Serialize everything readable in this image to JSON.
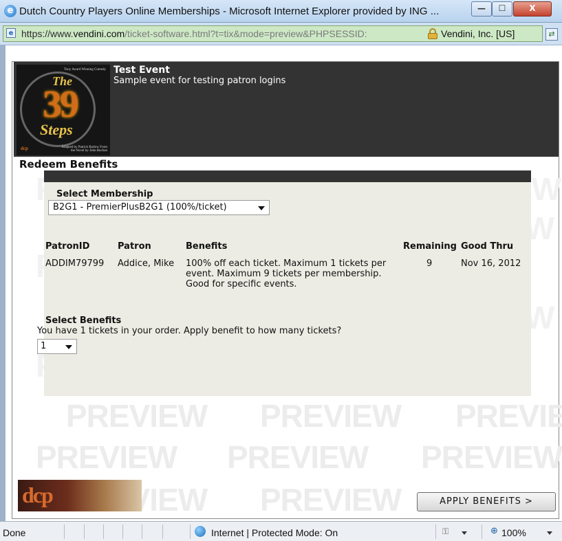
{
  "window": {
    "title": "Dutch Country Players Online Memberships - Microsoft Internet Explorer provided by ING ...",
    "minimize_glyph": "—",
    "maximize_glyph": "☐",
    "close_glyph": "X"
  },
  "address_bar": {
    "url_scheme": "https://www.",
    "url_domain": "vendini.com",
    "url_path": "/ticket-software.html?t=tix&mode=preview&PHPSESSID:",
    "certificate": "Vendini, Inc. [US]"
  },
  "event": {
    "poster_tagline": "Tony Award Winning Comedy",
    "poster_the": "The",
    "poster_number": "39",
    "poster_steps": "Steps",
    "poster_credit": "Adapted by Patrick Barlow From the Novel by John Buchan",
    "poster_brand": "dcp",
    "title": "Test Event",
    "subtitle": "Sample event for testing patron logins"
  },
  "redeem": {
    "section_title": "Redeem Benefits",
    "select_membership_label": "Select Membership",
    "select_membership_value": "B2G1 - PremierPlusB2G1 (100%/ticket)",
    "table": {
      "headers": [
        "PatronID",
        "Patron",
        "Benefits",
        "Remaining",
        "Good Thru"
      ],
      "rows": [
        {
          "patron_id": "ADDIM79799",
          "patron": "Addice, Mike",
          "benefits": "100% off each ticket. Maximum 1 tickets per event. Maximum 9 tickets per membership. Good for specific events.",
          "remaining": "9",
          "good_thru": "Nov 16, 2012"
        }
      ]
    },
    "select_benefits_label": "Select Benefits",
    "select_benefits_question": "You have 1 tickets in your order. Apply benefit to how many tickets?",
    "select_benefits_value": "1",
    "apply_button": "APPLY BENEFITS >"
  },
  "watermark": "PREVIEW",
  "footer": {
    "logo": "dcp"
  },
  "status_bar": {
    "status": "Done",
    "zone": "Internet | Protected Mode: On",
    "zoom": "100%"
  },
  "colors": {
    "header_bg": "#333333",
    "panel_bg": "#ecece4",
    "address_bg": "#cde8c5",
    "close_button": "#c4442f"
  }
}
